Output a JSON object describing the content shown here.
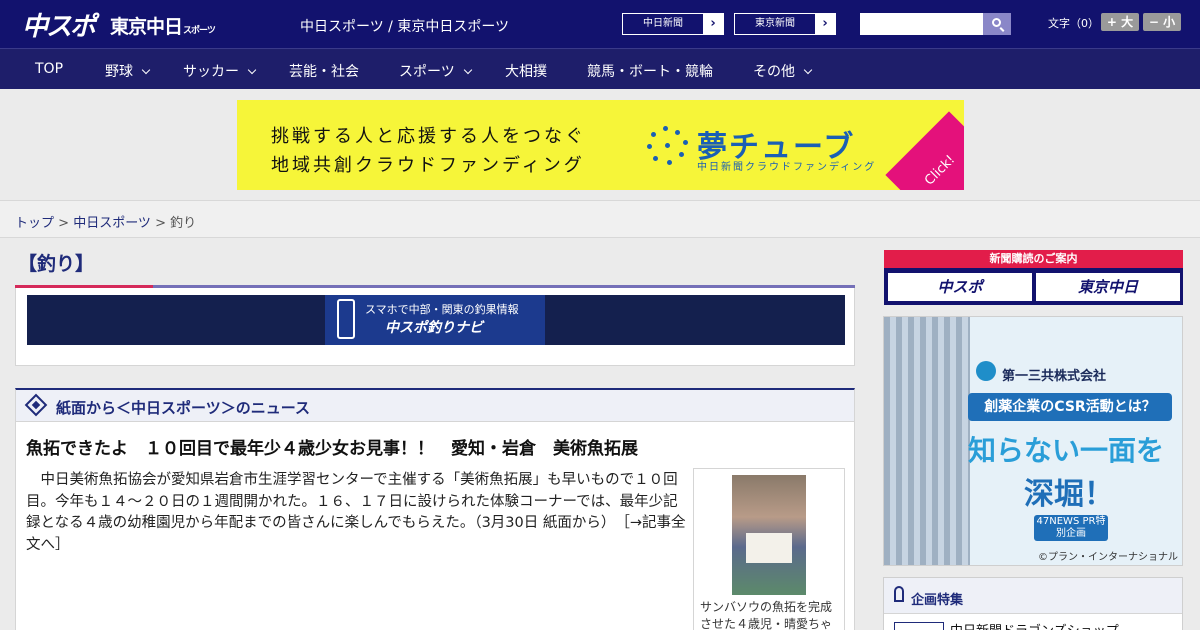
{
  "header": {
    "logo_chuspo": "中スポ",
    "logo_tokyo": "東京中日",
    "logo_tokyo_small": "スポーツ",
    "site_title": "中日スポーツ / 東京中日スポーツ",
    "paper_buttons": [
      "中日新聞",
      "東京新聞"
    ],
    "search_placeholder": "",
    "fontsize_label": "文字（0）",
    "fontsize_up": "+ 大",
    "fontsize_down": "− 小"
  },
  "nav": {
    "items": [
      {
        "label": "TOP",
        "dropdown": false
      },
      {
        "label": "野球",
        "dropdown": true
      },
      {
        "label": "サッカー",
        "dropdown": true
      },
      {
        "label": "芸能・社会",
        "dropdown": false
      },
      {
        "label": "スポーツ",
        "dropdown": true
      },
      {
        "label": "大相撲",
        "dropdown": false
      },
      {
        "label": "競馬・ボート・競輪",
        "dropdown": false
      },
      {
        "label": "その他",
        "dropdown": true
      }
    ]
  },
  "banner": {
    "line1": "挑戦する人と応援する人をつなぐ",
    "line2": "地域共創クラウドファンディング",
    "brand": "夢チューブ",
    "sub": "中日新聞クラウドファンディング",
    "click": "Click!"
  },
  "breadcrumb": {
    "items": [
      "トップ",
      "中日スポーツ"
    ],
    "current": "釣り"
  },
  "page": {
    "title": "【釣り】",
    "navi_line1": "スマホで中部・関東の釣果情報",
    "navi_line2": "中スポ釣りナビ"
  },
  "news": {
    "section_title": "紙面から＜中日スポーツ＞のニュース",
    "article_title": "魚拓できたよ　１０回目で最年少４歳少女お見事！！　愛知・岩倉　美術魚拓展",
    "article_body": "中日美術魚拓協会が愛知県岩倉市生涯学習センターで主催する「美術魚拓展」も早いもので１０回目。今年も１４～２０日の１週間開かれた。１６、１７日に設けられた体験コーナーでは、最年少記録となる４歳の幼稚園児から年配までの皆さんに楽しんでもらえた。（3月30日 紙面から）",
    "more_link": "［→記事全文へ］",
    "photo_caption": "サンバソウの魚拓を完成させた４歳児・晴愛ちゃ"
  },
  "sidebar": {
    "subscribe_head": "新聞購読のご案内",
    "subscribe_buttons": [
      "中スポ",
      "東京中日"
    ],
    "ad_company": "第一三共株式会社",
    "ad_csr": "創薬企業のCSR活動とは？",
    "ad_big1": "知らない一面を",
    "ad_big2": "深堀！",
    "ad_tag": "47NEWS PR特別企画",
    "ad_credit": "©プラン・インターナショナル",
    "feature_title": "企画特集",
    "feature_item": "中日新聞ドラゴンズショップ"
  }
}
